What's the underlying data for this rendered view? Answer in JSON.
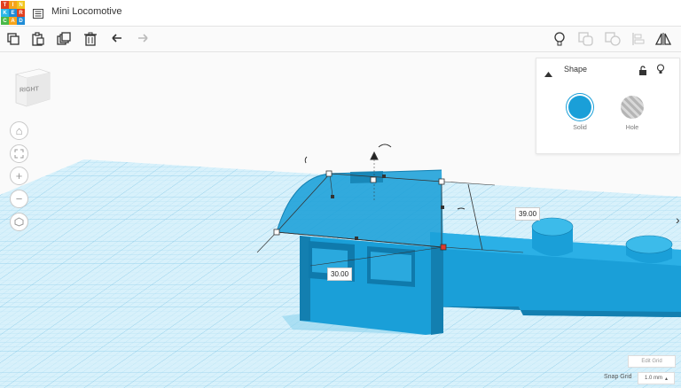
{
  "app": {
    "logo_letters": [
      "T",
      "I",
      "N",
      "K",
      "E",
      "R",
      "C",
      "A",
      "D"
    ],
    "logo_colors": [
      "#e2401f",
      "#f6a41b",
      "#f2c51a",
      "#2cb7e7",
      "#1f8cd6",
      "#e2401f",
      "#49b847",
      "#f6a41b",
      "#1f8cd6"
    ],
    "project_title": "Mini Locomotive"
  },
  "toolbar": {
    "left_icons": [
      "copy-icon",
      "paste-icon",
      "duplicate-icon",
      "delete-icon",
      "undo-icon",
      "redo-icon"
    ],
    "right_icons": [
      "light-bulb-icon",
      "group-icon",
      "ungroup-icon",
      "align-icon",
      "mirror-icon"
    ]
  },
  "viewcube": {
    "face_label": "RIGHT"
  },
  "nav_buttons": [
    "home-icon",
    "fit-view-icon",
    "zoom-in-icon",
    "zoom-out-icon",
    "perspective-icon"
  ],
  "shape_panel": {
    "title": "Shape",
    "solid_label": "Solid",
    "hole_label": "Hole",
    "solid_color": "#1a9fd8",
    "hole_color": "#b5b5b5"
  },
  "dimensions": {
    "width": "30.00",
    "height": "39.00"
  },
  "grid": {
    "edit_grid_label": "Edit Grid",
    "snap_label": "Snap Grid",
    "snap_value": "1.0 mm"
  },
  "colors": {
    "grid_plane": "#d8f1fb",
    "grid_line": "#a7dbf1",
    "shape_blue": "#1a9fd8",
    "shape_dark": "#137fb0"
  }
}
